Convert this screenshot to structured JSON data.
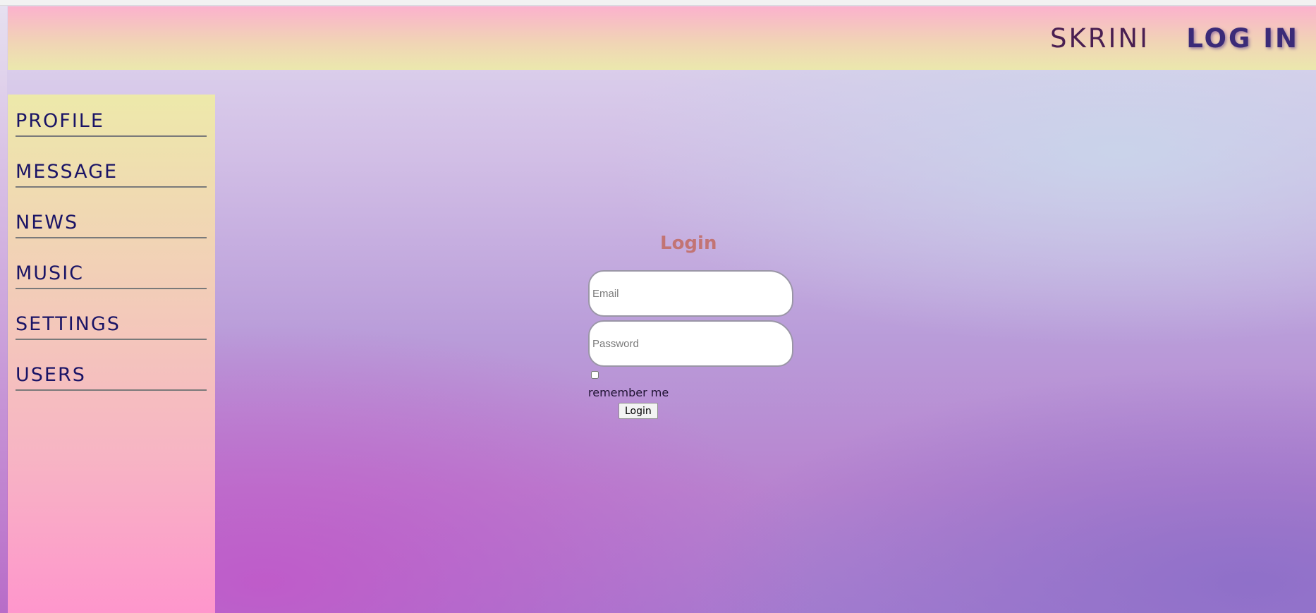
{
  "header": {
    "brand": "SKRINI",
    "login_link": "LOG IN"
  },
  "sidebar": {
    "items": [
      {
        "label": "PROFILE"
      },
      {
        "label": "MESSAGE"
      },
      {
        "label": "NEWS"
      },
      {
        "label": "MUSIC"
      },
      {
        "label": "SETTINGS"
      },
      {
        "label": "USERS"
      }
    ]
  },
  "login_form": {
    "title": "Login",
    "email_placeholder": "Email",
    "password_placeholder": "Password",
    "remember_label": "remember me",
    "submit_label": "Login"
  }
}
